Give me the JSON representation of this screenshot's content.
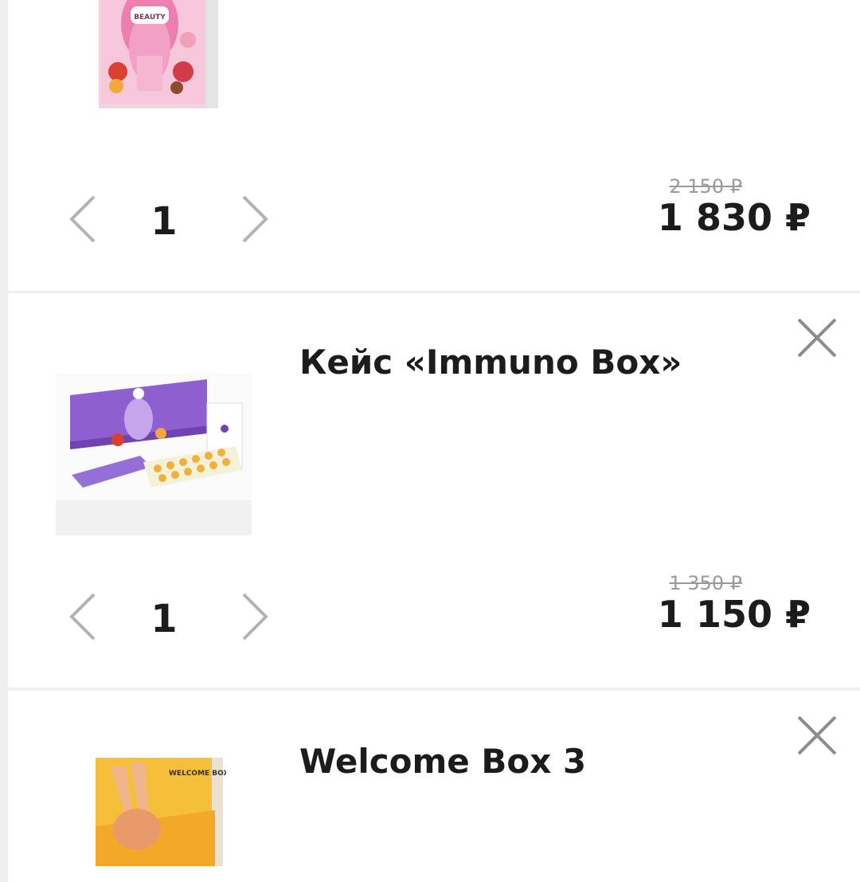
{
  "currency_symbol": "₽",
  "icons": {
    "prev": "chevron-left-icon",
    "next": "chevron-right-icon",
    "remove": "close-icon"
  },
  "cart_items": [
    {
      "title": "",
      "image_label": "BEAUTY",
      "quantity": "1",
      "old_price": "2 150 ₽",
      "price": "1 830 ₽"
    },
    {
      "title": "Кейс «Immuno Box»",
      "quantity": "1",
      "old_price": "1 350 ₽",
      "price": "1 150 ₽"
    },
    {
      "title": "Welcome Box 3",
      "image_label": "WELCOME BOX"
    }
  ]
}
